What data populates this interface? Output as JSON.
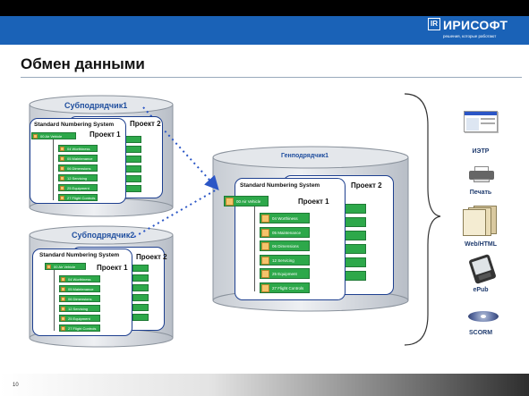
{
  "logo": {
    "mark": "IR",
    "name": "ИРИСОФТ",
    "tagline": "решения, которые работают"
  },
  "title": "Обмен данными",
  "page_number": "10",
  "sub1": {
    "name": "Субподрядчик1",
    "project2": "Проект 2",
    "project1": "Проект 1",
    "sns": "Standard Numbering System",
    "root": "00 Air Vehicle",
    "items": [
      "04 Worthiness",
      "05 Maintenance",
      "06 Dimensions",
      "12 Servicing",
      "25 Equipment",
      "27 Flight Controls"
    ]
  },
  "sub2": {
    "name": "Субподрядчик2",
    "project2": "Проект 2",
    "project1": "Проект 1",
    "sns": "Standard Numbering System",
    "root": "00 Air Vehicle",
    "items": [
      "04 Worthiness",
      "05 Maintenance",
      "06 Dimensions",
      "12 Servicing",
      "25 Equipment",
      "27 Flight Controls"
    ]
  },
  "main": {
    "name": "Генподрядчик1",
    "project2": "Проект 2",
    "project1": "Проект 1",
    "sns": "Standard Numbering System",
    "root": "00 Air Vehicle",
    "items": [
      "04 Worthiness",
      "05 Maintenance",
      "06 Dimensions",
      "12 Servicing",
      "25 Equipment",
      "27 Flight Controls"
    ]
  },
  "outputs": [
    {
      "label": "ИЭТР",
      "icon": "ietm-screen-icon"
    },
    {
      "label": "Печать",
      "icon": "printer-icon"
    },
    {
      "label": "Web/HTML",
      "icon": "web-html-icon"
    },
    {
      "label": "ePub",
      "icon": "epub-reader-icon"
    },
    {
      "label": "SCORM",
      "icon": "scorm-disc-icon"
    }
  ],
  "colors": {
    "header": "#000000",
    "bar": "#1a62b7",
    "db_border": "#1d3f8f",
    "tree_item": "#2da84a",
    "arrow": "#2b56c6"
  }
}
